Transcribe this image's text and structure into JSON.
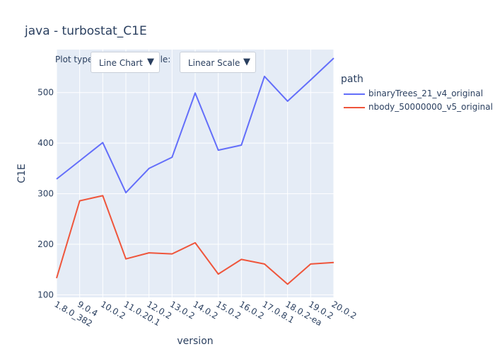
{
  "chart_data": {
    "type": "line",
    "title": "java - turbostat_C1E",
    "xlabel": "version",
    "ylabel": "C1E",
    "categories": [
      "1.8.0_382",
      "9.0.4",
      "10.0.2",
      "11.0.20.1",
      "12.0.2",
      "13.0.2",
      "14.0.2",
      "15.0.2",
      "16.0.2",
      "17.0.8.1",
      "18.0.2-ea",
      "19.0.2",
      "20.0.2"
    ],
    "ylim": [
      95,
      585
    ],
    "yticks": [
      100,
      200,
      300,
      400,
      500
    ],
    "legend_title": "path",
    "legend_position": "top-right",
    "grid": true,
    "plot_background": "#e5ecf6",
    "series": [
      {
        "name": "binaryTrees_21_v4_original",
        "color": "#636efa",
        "values": [
          329,
          365,
          401,
          302,
          350,
          372,
          499,
          386,
          396,
          532,
          483,
          525,
          568
        ]
      },
      {
        "name": "nbody_50000000_v5_original",
        "color": "#ef553b",
        "values": [
          133,
          286,
          296,
          171,
          183,
          181,
          203,
          141,
          170,
          161,
          121,
          161,
          164
        ]
      }
    ]
  },
  "controls": {
    "plot_type_label": "Plot type:",
    "plot_type_value": "Line Chart",
    "scale_label": "Scale:",
    "scale_value": "Linear Scale",
    "caret": "▼"
  }
}
